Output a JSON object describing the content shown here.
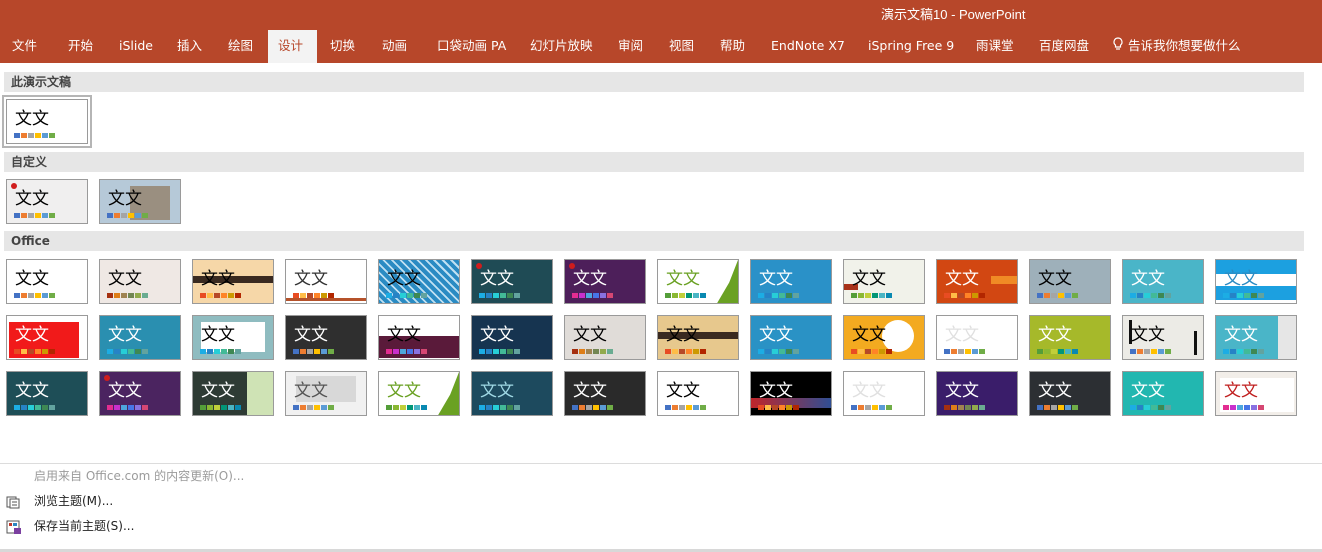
{
  "window": {
    "title": "演示文稿10  -  PowerPoint"
  },
  "ribbon": {
    "tabs": [
      "文件",
      "开始",
      "iSlide",
      "插入",
      "绘图",
      "设计",
      "切换",
      "动画",
      "口袋动画 PA",
      "幻灯片放映",
      "审阅",
      "视图",
      "帮助",
      "EndNote X7",
      "iSpring Free 9",
      "雨课堂",
      "百度网盘"
    ],
    "active_tab": "设计",
    "tell_me": "告诉我你想要做什么",
    "accent_color": "#b7472a"
  },
  "gallery": {
    "sections": {
      "this_presentation": "此演示文稿",
      "custom": "自定义",
      "office": "Office"
    },
    "thumb_text": "文文"
  },
  "menu": {
    "enable_updates": "启用来自 Office.com 的内容更新(O)...",
    "browse_themes": "浏览主题(M)...",
    "save_theme": "保存当前主题(S)..."
  }
}
